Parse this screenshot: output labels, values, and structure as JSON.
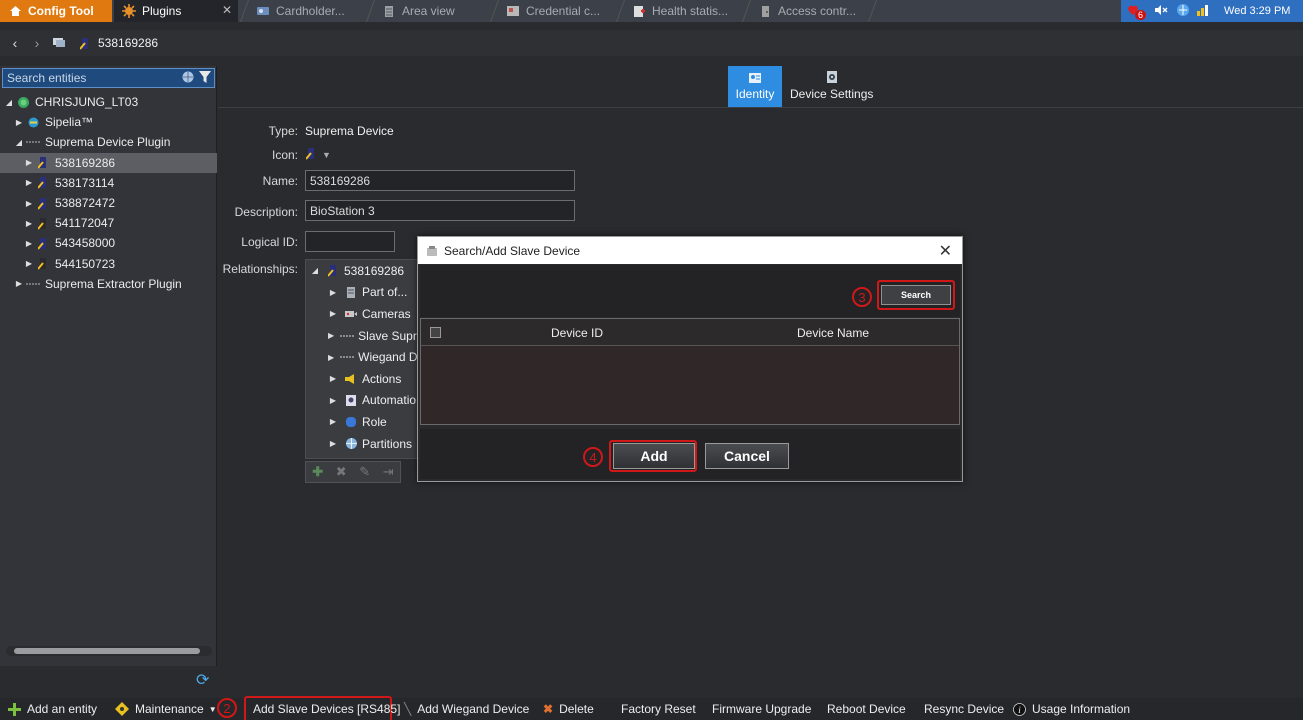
{
  "tabs": [
    {
      "label": "Config Tool",
      "icon": "home-icon"
    },
    {
      "label": "Plugins",
      "icon": "plugins-icon"
    },
    {
      "label": "Cardholder...",
      "icon": "cardholder-icon"
    },
    {
      "label": "Area view",
      "icon": "area-view-icon"
    },
    {
      "label": "Credential c...",
      "icon": "credential-icon"
    },
    {
      "label": "Health statis...",
      "icon": "health-icon"
    },
    {
      "label": "Access contr...",
      "icon": "access-control-icon"
    }
  ],
  "systray": {
    "notification_count": "6",
    "time": "Wed 3:29 PM"
  },
  "nav": {
    "breadcrumb": "538169286"
  },
  "search": {
    "placeholder": "Search entities"
  },
  "tree": {
    "root": "CHRISJUNG_LT03",
    "items": [
      {
        "label": "Sipelia™"
      },
      {
        "label": "Suprema Device Plugin"
      },
      {
        "label": "538169286"
      },
      {
        "label": "538173114"
      },
      {
        "label": "538872472"
      },
      {
        "label": "541172047"
      },
      {
        "label": "543458000"
      },
      {
        "label": "544150723"
      },
      {
        "label": "Suprema Extractor Plugin"
      }
    ]
  },
  "view_tabs": [
    {
      "label": "Identity"
    },
    {
      "label": "Device Settings"
    }
  ],
  "form": {
    "type_label": "Type:",
    "type_value": "Suprema Device",
    "icon_label": "Icon:",
    "name_label": "Name:",
    "name_value": "538169286",
    "description_label": "Description:",
    "description_value": "BioStation 3",
    "logical_id_label": "Logical ID:",
    "logical_id_value": "",
    "relationships_label": "Relationships:"
  },
  "relationships": {
    "root": "538169286",
    "items": [
      {
        "label": "Part of..."
      },
      {
        "label": "Cameras"
      },
      {
        "label": "Slave Supre"
      },
      {
        "label": "Wiegand D"
      },
      {
        "label": "Actions"
      },
      {
        "label": "Automatio"
      },
      {
        "label": "Role"
      },
      {
        "label": "Partitions"
      }
    ]
  },
  "dialog": {
    "title": "Search/Add Slave Device",
    "search_label": "Search",
    "columns": [
      "Device ID",
      "Device Name"
    ],
    "add_label": "Add",
    "cancel_label": "Cancel",
    "step3": "3",
    "step4": "4"
  },
  "toolbar": {
    "add_entity": "Add an entity",
    "maintenance": "Maintenance",
    "step2": "2",
    "add_slave": "Add Slave Devices [RS485]",
    "add_wiegand": "Add Wiegand Device",
    "delete": "Delete",
    "factory_reset": "Factory Reset",
    "firmware_upgrade": "Firmware Upgrade",
    "reboot": "Reboot Device",
    "resync": "Resync Device",
    "usage_info": "Usage Information"
  },
  "colors": {
    "accent": "#2e8de0",
    "home_tab": "#e07a10",
    "annotation": "#d01818"
  }
}
